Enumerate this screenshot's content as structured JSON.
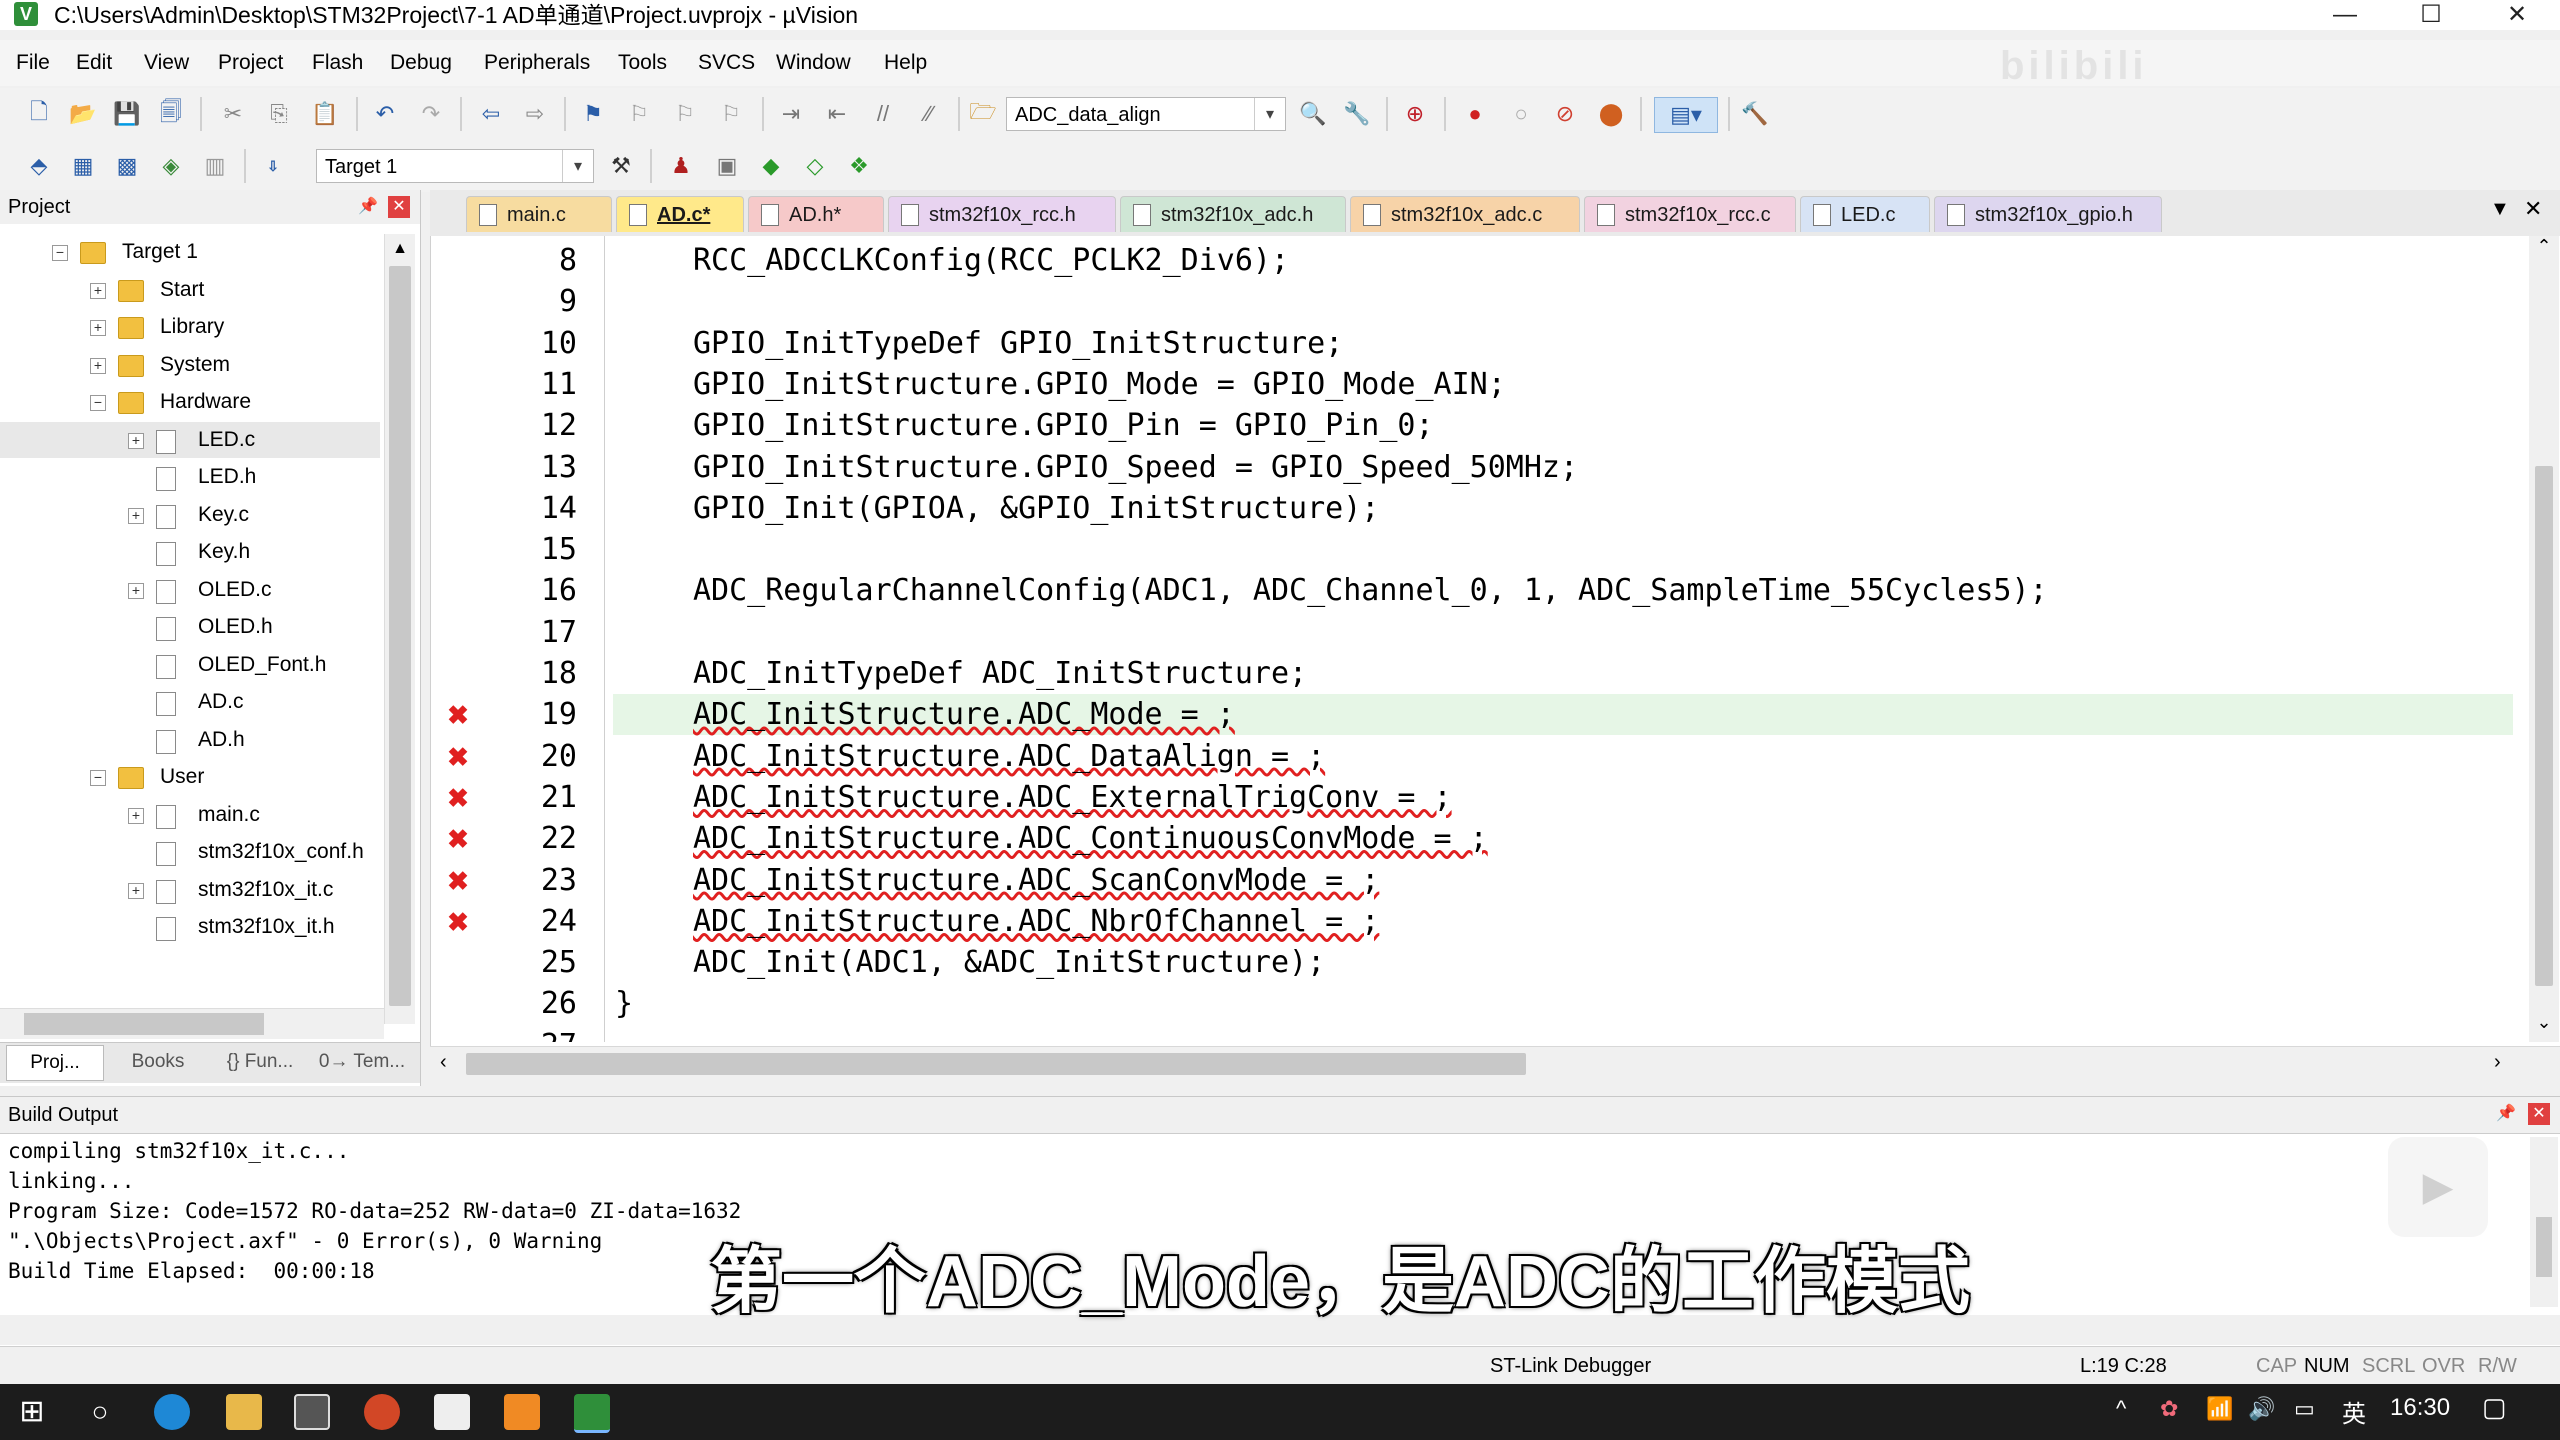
{
  "window": {
    "title": "C:\\Users\\Admin\\Desktop\\STM32Project\\7-1 AD单通道\\Project.uvprojx - µVision",
    "minimize": "—",
    "maximize": "☐",
    "close": "✕"
  },
  "watermark": "bilibili",
  "menu": [
    "File",
    "Edit",
    "View",
    "Project",
    "Flash",
    "Debug",
    "Peripherals",
    "Tools",
    "SVCS",
    "Window",
    "Help"
  ],
  "toolbar1": {
    "find_combo": "ADC_data_align"
  },
  "toolbar2": {
    "target_combo": "Target 1"
  },
  "project_panel": {
    "title": "Project",
    "tree": [
      {
        "label": "Target 1",
        "level": 0,
        "type": "folder",
        "expander": "−"
      },
      {
        "label": "Start",
        "level": 1,
        "type": "folder",
        "expander": "+"
      },
      {
        "label": "Library",
        "level": 1,
        "type": "folder",
        "expander": "+"
      },
      {
        "label": "System",
        "level": 1,
        "type": "folder",
        "expander": "+"
      },
      {
        "label": "Hardware",
        "level": 1,
        "type": "folder",
        "expander": "−"
      },
      {
        "label": "LED.c",
        "level": 2,
        "type": "file",
        "expander": "+"
      },
      {
        "label": "LED.h",
        "level": 2,
        "type": "file",
        "expander": ""
      },
      {
        "label": "Key.c",
        "level": 2,
        "type": "file",
        "expander": "+"
      },
      {
        "label": "Key.h",
        "level": 2,
        "type": "file",
        "expander": ""
      },
      {
        "label": "OLED.c",
        "level": 2,
        "type": "file",
        "expander": "+"
      },
      {
        "label": "OLED.h",
        "level": 2,
        "type": "file",
        "expander": ""
      },
      {
        "label": "OLED_Font.h",
        "level": 2,
        "type": "file",
        "expander": ""
      },
      {
        "label": "AD.c",
        "level": 2,
        "type": "file",
        "expander": ""
      },
      {
        "label": "AD.h",
        "level": 2,
        "type": "file",
        "expander": ""
      },
      {
        "label": "User",
        "level": 1,
        "type": "folder",
        "expander": "−"
      },
      {
        "label": "main.c",
        "level": 2,
        "type": "file",
        "expander": "+"
      },
      {
        "label": "stm32f10x_conf.h",
        "level": 2,
        "type": "file",
        "expander": ""
      },
      {
        "label": "stm32f10x_it.c",
        "level": 2,
        "type": "file",
        "expander": "+"
      },
      {
        "label": "stm32f10x_it.h",
        "level": 2,
        "type": "file",
        "expander": ""
      }
    ],
    "bottom_tabs": [
      "Proj...",
      "Books",
      "{} Fun...",
      "0→ Tem..."
    ]
  },
  "editor": {
    "tabs": [
      {
        "label": "main.c",
        "color": "#f7dca0"
      },
      {
        "label": "AD.c*",
        "color": "#f4e27a",
        "active": true
      },
      {
        "label": "AD.h*",
        "color": "#f6c9c9"
      },
      {
        "label": "stm32f10x_rcc.h",
        "color": "#e8d3f0"
      },
      {
        "label": "stm32f10x_adc.h",
        "color": "#cfe6d5"
      },
      {
        "label": "stm32f10x_adc.c",
        "color": "#f7d3a8"
      },
      {
        "label": "stm32f10x_rcc.c",
        "color": "#f2d2e0"
      },
      {
        "label": "LED.c",
        "color": "#d7e3f5"
      },
      {
        "label": "stm32f10x_gpio.h",
        "color": "#ddd6ef"
      }
    ],
    "lines": [
      {
        "n": "8",
        "text": "RCC_ADCCLKConfig(RCC_PCLK2_Div6);",
        "error": false
      },
      {
        "n": "9",
        "text": "",
        "error": false
      },
      {
        "n": "10",
        "text": "GPIO_InitTypeDef GPIO_InitStructure;",
        "error": false
      },
      {
        "n": "11",
        "text": "GPIO_InitStructure.GPIO_Mode = GPIO_Mode_AIN;",
        "error": false
      },
      {
        "n": "12",
        "text": "GPIO_InitStructure.GPIO_Pin = GPIO_Pin_0;",
        "error": false
      },
      {
        "n": "13",
        "text": "GPIO_InitStructure.GPIO_Speed = GPIO_Speed_50MHz;",
        "error": false
      },
      {
        "n": "14",
        "text": "GPIO_Init(GPIOA, &GPIO_InitStructure);",
        "error": false
      },
      {
        "n": "15",
        "text": "",
        "error": false
      },
      {
        "n": "16",
        "text": "ADC_RegularChannelConfig(ADC1, ADC_Channel_0, 1, ADC_SampleTime_55Cycles5);",
        "error": false
      },
      {
        "n": "17",
        "text": "",
        "error": false
      },
      {
        "n": "18",
        "text": "ADC_InitTypeDef ADC_InitStructure;",
        "error": false
      },
      {
        "n": "19",
        "text": "ADC_InitStructure.ADC_Mode = ;",
        "error": true,
        "current": true
      },
      {
        "n": "20",
        "text": "ADC_InitStructure.ADC_DataAlign = ;",
        "error": true
      },
      {
        "n": "21",
        "text": "ADC_InitStructure.ADC_ExternalTrigConv = ;",
        "error": true
      },
      {
        "n": "22",
        "text": "ADC_InitStructure.ADC_ContinuousConvMode = ;",
        "error": true
      },
      {
        "n": "23",
        "text": "ADC_InitStructure.ADC_ScanConvMode = ;",
        "error": true
      },
      {
        "n": "24",
        "text": "ADC_InitStructure.ADC_NbrOfChannel = ;",
        "error": true
      },
      {
        "n": "25",
        "text": "ADC_Init(ADC1, &ADC_InitStructure);",
        "error": false
      },
      {
        "n": "26",
        "text": "}",
        "error": false,
        "indent": 0
      },
      {
        "n": "27",
        "text": "",
        "error": false
      }
    ]
  },
  "build_output": {
    "title": "Build Output",
    "lines": [
      "compiling stm32f10x_it.c...",
      "linking...",
      "Program Size: Code=1572 RO-data=252 RW-data=0 ZI-data=1632",
      "\".\\Objects\\Project.axf\" - 0 Error(s), 0 Warning",
      "Build Time Elapsed:  00:00:18"
    ]
  },
  "subtitle": "第一个ADC_Mode，是ADC的工作模式",
  "status": {
    "debugger": "ST-Link Debugger",
    "position": "L:19 C:28",
    "cap": "CAP",
    "num": "NUM",
    "scrl": "SCRL",
    "ovr": "OVR",
    "rw": "R/W"
  },
  "taskbar": {
    "ime": "英",
    "time": "16:30"
  }
}
